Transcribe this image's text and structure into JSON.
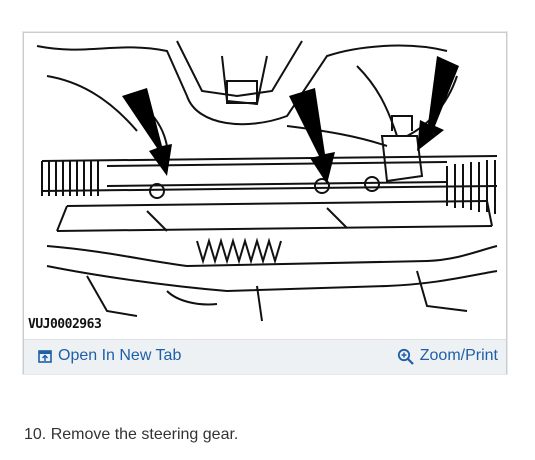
{
  "figure": {
    "diagram_code": "VUJ0002963",
    "open_tab_label": "Open In New Tab",
    "zoom_print_label": "Zoom/Print",
    "link_color": "#1f5fa8"
  },
  "step": {
    "text": "10. Remove the steering gear."
  },
  "icons": {
    "open_tab": "open-in-new-tab-icon",
    "zoom": "zoom-in-icon"
  }
}
